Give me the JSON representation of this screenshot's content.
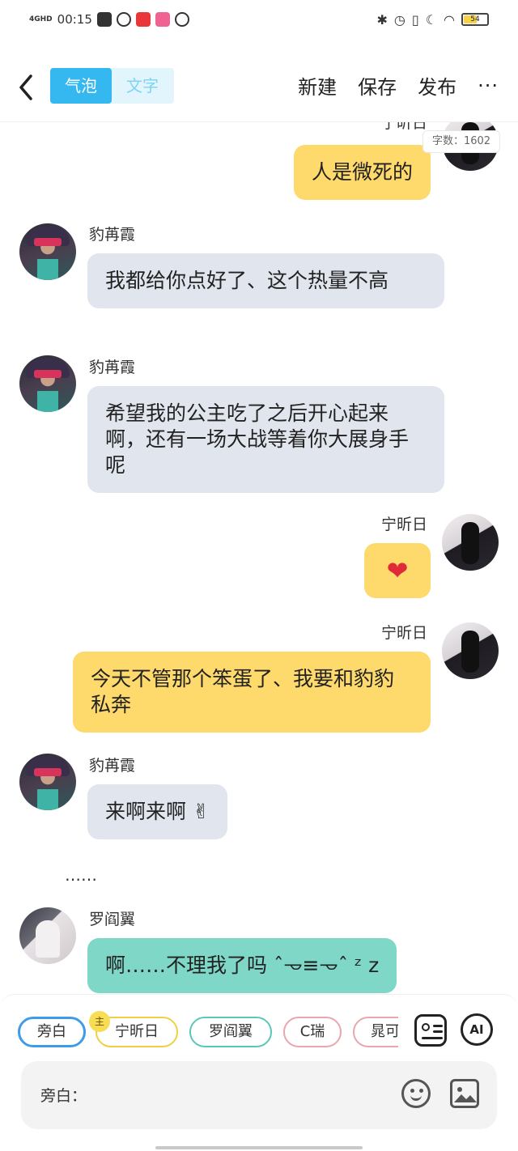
{
  "status_bar": {
    "network": "4GHD",
    "time": "00:15",
    "battery": "54",
    "battery_level": 0.54,
    "app_icon_colors": [
      "#333333",
      "#333333",
      "#e8363b",
      "#f06292",
      "#333333"
    ]
  },
  "nav": {
    "tabs": [
      "气泡",
      "文字"
    ],
    "active_tab": 0,
    "new_label": "新建",
    "save_label": "保存",
    "publish_label": "发布",
    "more_label": "···"
  },
  "word_count": "字数：1602",
  "messages": [
    {
      "side": "right",
      "name": "宁昕日",
      "text": "人是微死的",
      "color": "yellow"
    },
    {
      "side": "left",
      "name": "豹苒霞",
      "text": "我都给你点好了、这个热量不高",
      "color": "grey"
    },
    {
      "side": "left",
      "name": "豹苒霞",
      "text": "希望我的公主吃了之后开心起来啊，还有一场大战等着你大展身手呢",
      "color": "grey"
    },
    {
      "side": "right",
      "name": "宁昕日",
      "text": "❤",
      "color": "yellow"
    },
    {
      "side": "right",
      "name": "宁昕日",
      "text": "今天不管那个笨蛋了、我要和豹豹私奔",
      "color": "yellow"
    },
    {
      "side": "left",
      "name": "豹苒霞",
      "text": "来啊来啊 ✌",
      "color": "grey"
    },
    {
      "side": "left",
      "name": "罗阎翼",
      "text": "啊……不理我了吗 ˆ𐃷≡𐃷ˆ ᶻ z",
      "color": "teal"
    }
  ],
  "ellipsis": "……",
  "role_chips": [
    {
      "label": "旁白",
      "color": "#3d9be9",
      "selected": true
    },
    {
      "label": "宁昕日",
      "color": "#f0cf45",
      "selected": false
    },
    {
      "label": "罗阎翼",
      "color": "#59c7b9",
      "selected": false
    },
    {
      "label": "C瑞",
      "color": "#eaa5ad",
      "selected": false
    },
    {
      "label": "晁可",
      "color": "#eaa5ad",
      "selected": false
    }
  ],
  "crown_label": "主",
  "ai_label": "AI",
  "input_prefix": "旁白："
}
